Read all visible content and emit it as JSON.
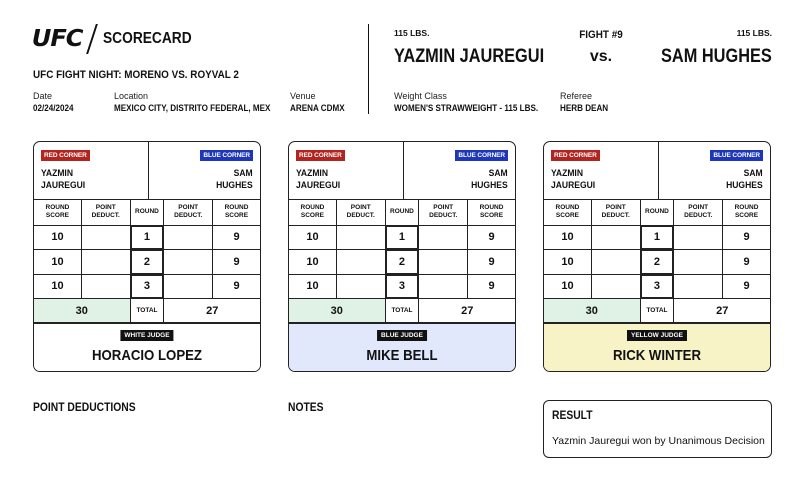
{
  "header": {
    "logo": "UFC",
    "title": "SCORECARD",
    "event": "UFC FIGHT NIGHT: MORENO VS. ROYVAL 2",
    "date_label": "Date",
    "date": "02/24/2024",
    "location_label": "Location",
    "location": "MEXICO CITY, DISTRITO FEDERAL, MEX",
    "venue_label": "Venue",
    "venue": "ARENA CDMX",
    "weight_class_label": "Weight Class",
    "weight_class": "WOMEN'S STRAWWEIGHT - 115 LBS.",
    "referee_label": "Referee",
    "referee": "HERB DEAN"
  },
  "fight": {
    "number": "FIGHT #9",
    "vs": "vs.",
    "red": {
      "weight": "115 LBS.",
      "name": "YAZMIN JAUREGUI",
      "first": "YAZMIN",
      "last": "JAUREGUI"
    },
    "blue": {
      "weight": "115 LBS.",
      "name": "SAM HUGHES",
      "first": "SAM",
      "last": "HUGHES"
    }
  },
  "labels": {
    "red_corner": "RED CORNER",
    "blue_corner": "BLUE CORNER",
    "round_score": "ROUND\nSCORE",
    "point_deduct": "POINT\nDEDUCT.",
    "round": "ROUND",
    "total": "TOTAL"
  },
  "cards": [
    {
      "judge_badge": "WHITE JUDGE",
      "judge_name": "HORACIO LOPEZ",
      "bg": "#ffffff",
      "rounds": [
        {
          "round": "1",
          "red": "10",
          "red_ded": "",
          "blue_ded": "",
          "blue": "9"
        },
        {
          "round": "2",
          "red": "10",
          "red_ded": "",
          "blue_ded": "",
          "blue": "9"
        },
        {
          "round": "3",
          "red": "10",
          "red_ded": "",
          "blue_ded": "",
          "blue": "9"
        }
      ],
      "total_red": "30",
      "total_blue": "27"
    },
    {
      "judge_badge": "BLUE JUDGE",
      "judge_name": "MIKE BELL",
      "bg": "#e2e8fb",
      "rounds": [
        {
          "round": "1",
          "red": "10",
          "red_ded": "",
          "blue_ded": "",
          "blue": "9"
        },
        {
          "round": "2",
          "red": "10",
          "red_ded": "",
          "blue_ded": "",
          "blue": "9"
        },
        {
          "round": "3",
          "red": "10",
          "red_ded": "",
          "blue_ded": "",
          "blue": "9"
        }
      ],
      "total_red": "30",
      "total_blue": "27"
    },
    {
      "judge_badge": "YELLOW JUDGE",
      "judge_name": "RICK WINTER",
      "bg": "#f7f3c6",
      "rounds": [
        {
          "round": "1",
          "red": "10",
          "red_ded": "",
          "blue_ded": "",
          "blue": "9"
        },
        {
          "round": "2",
          "red": "10",
          "red_ded": "",
          "blue_ded": "",
          "blue": "9"
        },
        {
          "round": "3",
          "red": "10",
          "red_ded": "",
          "blue_ded": "",
          "blue": "9"
        }
      ],
      "total_red": "30",
      "total_blue": "27"
    }
  ],
  "footer": {
    "point_deductions": "POINT DEDUCTIONS",
    "notes": "NOTES",
    "result_title": "RESULT",
    "result_text": "Yazmin Jauregui won by Unanimous Decision"
  },
  "colors": {
    "red_corner": "#b3241f",
    "blue_corner": "#1d37b8",
    "total_highlight": "#e0f1e6"
  }
}
